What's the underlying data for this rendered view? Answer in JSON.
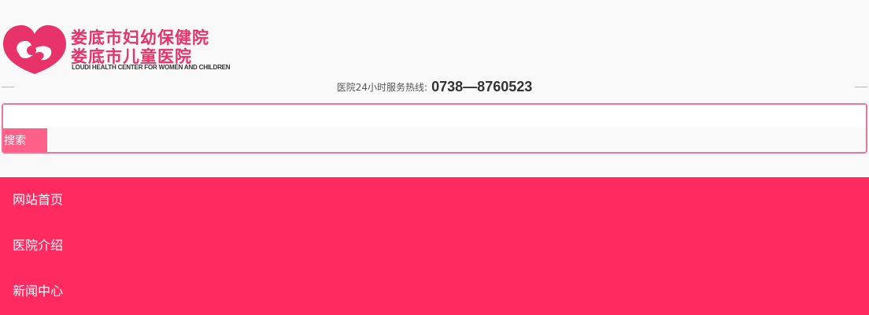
{
  "header": {
    "logo": {
      "name_line1": "娄底市妇幼保健院",
      "name_line2": "娄底市儿童医院",
      "name_en": "LOUDI HEALTH CENTER FOR WOMEN AND CHILDREN",
      "icon": "heart-logo-icon",
      "color": "#e8336a"
    },
    "hotline": {
      "label": "医院24小时服务热线:",
      "number": "0738—8760523"
    }
  },
  "search": {
    "input_value": "",
    "placeholder": "",
    "button_label": "搜索"
  },
  "nav": {
    "items": [
      {
        "label": "网站首页"
      },
      {
        "label": "医院介绍"
      },
      {
        "label": "新闻中心"
      }
    ]
  },
  "colors": {
    "nav_bg": "#ff2b60",
    "search_border": "#e8789a",
    "search_button_bg": "#ff6088"
  }
}
